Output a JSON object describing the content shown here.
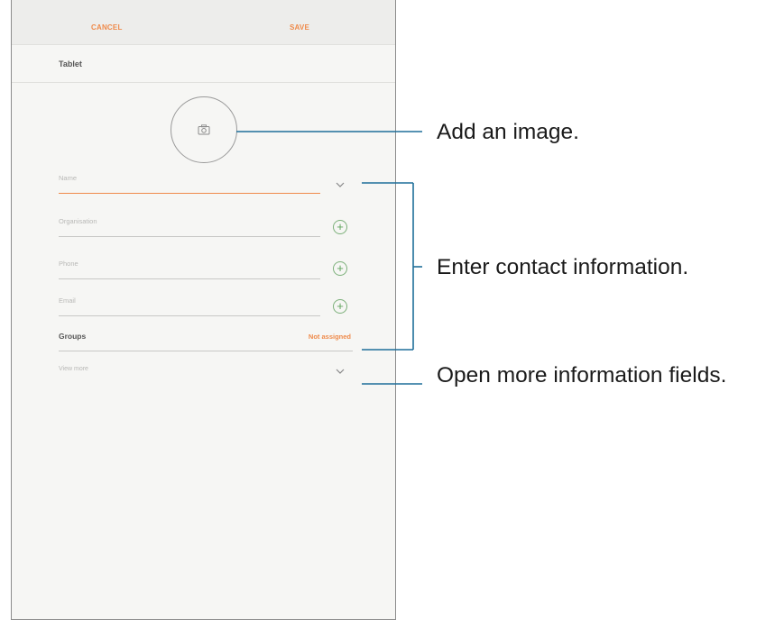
{
  "appbar": {
    "cancel_label": "CANCEL",
    "save_label": "SAVE"
  },
  "account": {
    "label": "Tablet"
  },
  "fields": {
    "name_placeholder": "Name",
    "organisation_placeholder": "Organisation",
    "phone_placeholder": "Phone",
    "email_placeholder": "Email"
  },
  "groups": {
    "label": "Groups",
    "value": "Not assigned"
  },
  "view_more": {
    "label": "View more"
  },
  "callouts": {
    "add_image": "Add an image.",
    "enter_contact": "Enter contact information.",
    "open_more": "Open more information fields."
  },
  "colors": {
    "accent": "#ef8a4a",
    "add_green": "#5da35a",
    "callout_line": "#1f6f9a"
  },
  "icons": [
    "camera-icon",
    "chevron-down-icon",
    "plus-icon"
  ]
}
